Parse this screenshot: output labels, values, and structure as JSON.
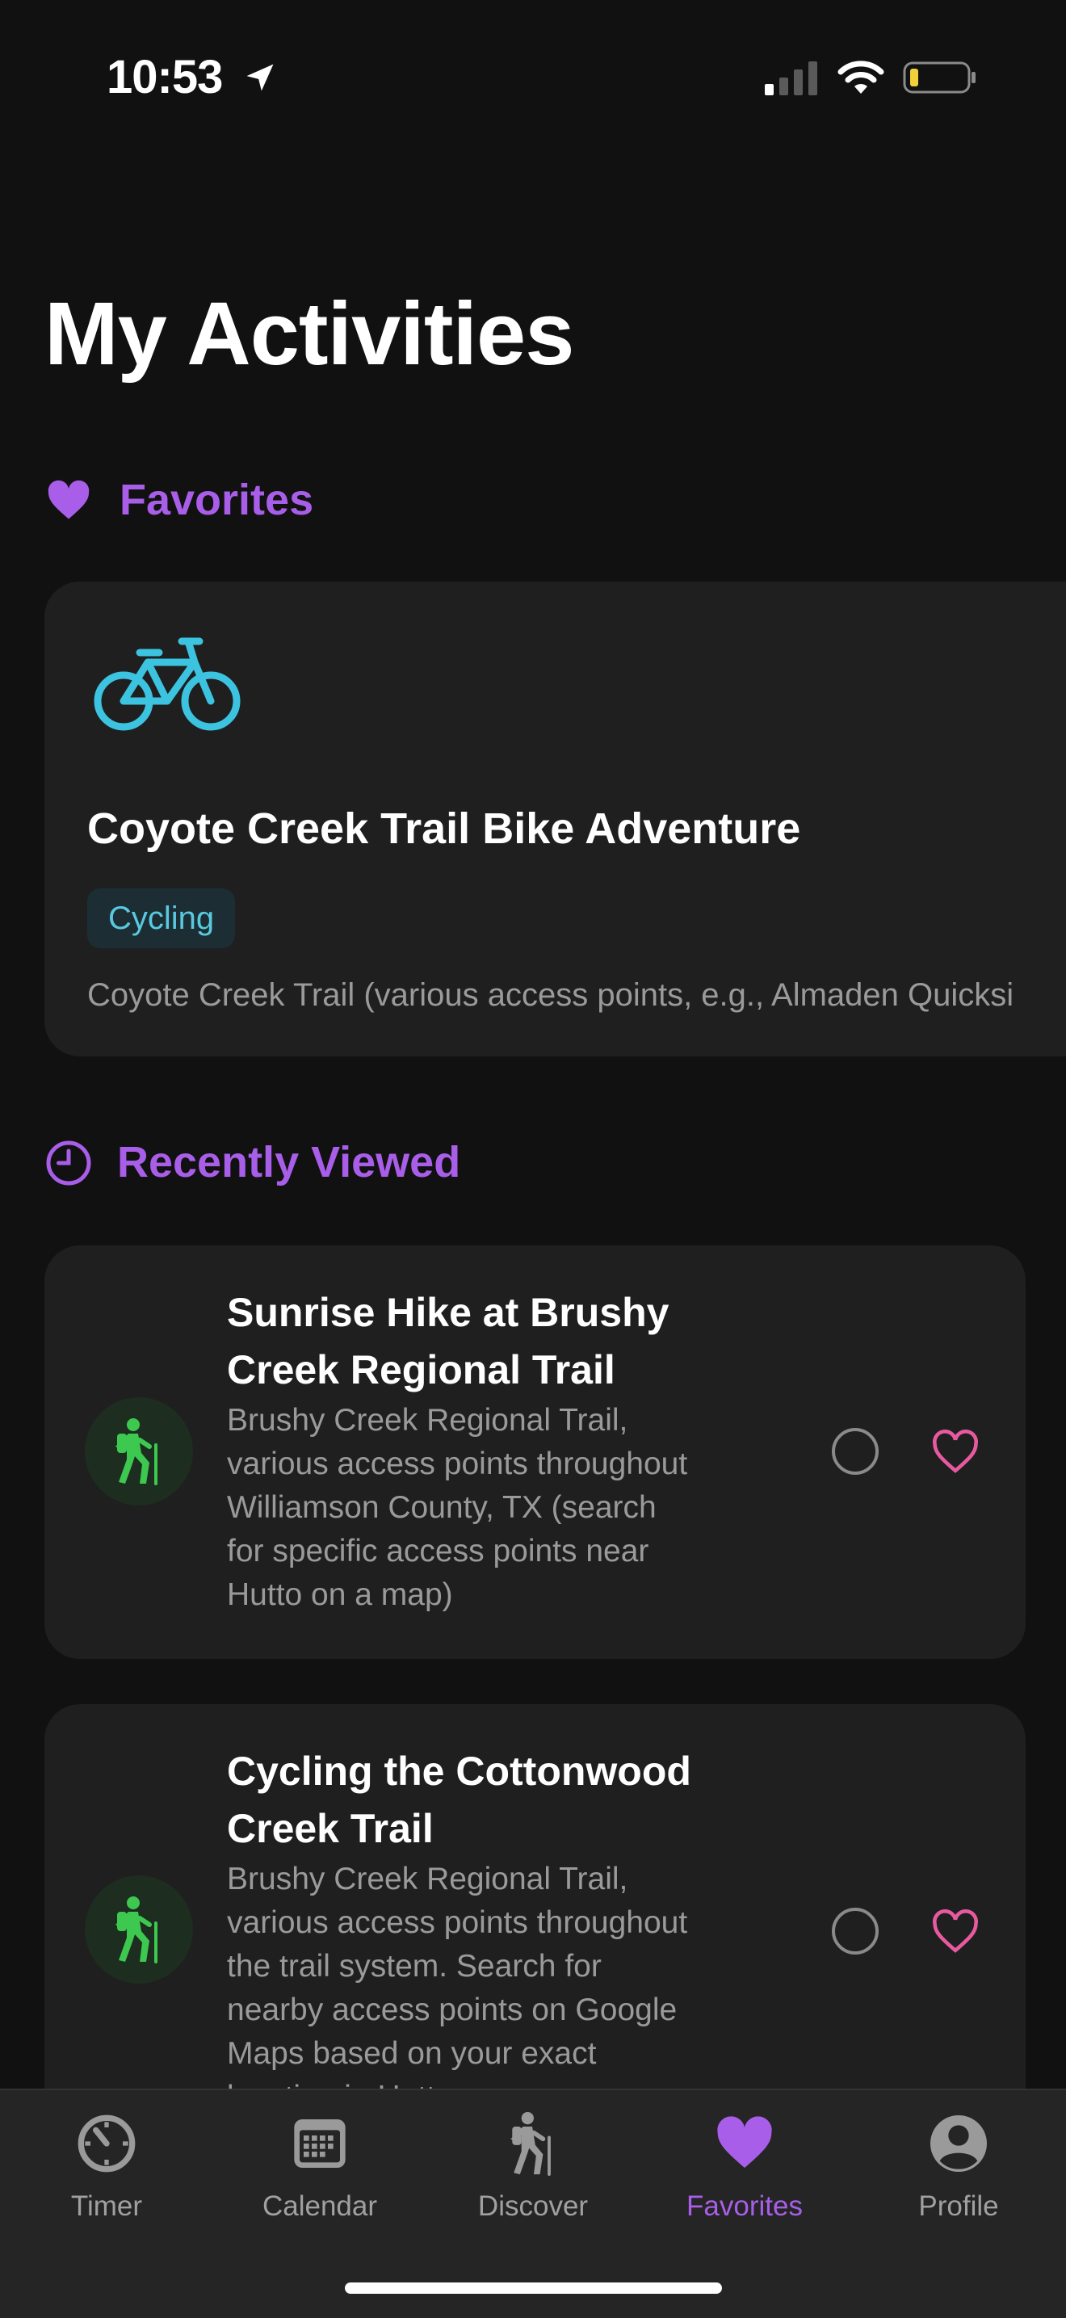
{
  "status_bar": {
    "time": "10:53"
  },
  "page": {
    "title": "My Activities"
  },
  "favorites": {
    "heading": "Favorites",
    "card": {
      "title": "Coyote Creek Trail Bike Adventure",
      "tag": "Cycling",
      "location": "Coyote Creek Trail (various access points, e.g., Almaden Quicksi",
      "icon": "bicycle-icon"
    }
  },
  "recently_viewed": {
    "heading": "Recently Viewed",
    "items": [
      {
        "title_line1": "Sunrise Hike at Brushy",
        "title_line2": "Creek Regional Trail",
        "desc_lines": [
          "Brushy Creek Regional Trail,",
          "various access points throughout",
          "Williamson County, TX (search",
          "for specific access points near",
          "Hutto on a map)"
        ],
        "icon": "hiker-icon"
      },
      {
        "title_line1": "Cycling the Cottonwood",
        "title_line2": "Creek Trail",
        "desc_lines": [
          "Brushy Creek Regional Trail,",
          "various access points throughout",
          "the trail system.  Search for",
          "nearby access points on Google",
          "Maps based on your exact",
          "location in Hutto."
        ],
        "icon": "hiker-icon"
      }
    ]
  },
  "tabs": [
    {
      "label": "Timer",
      "icon": "timer-icon"
    },
    {
      "label": "Calendar",
      "icon": "calendar-icon"
    },
    {
      "label": "Discover",
      "icon": "hiker-icon"
    },
    {
      "label": "Favorites",
      "icon": "heart-icon",
      "active": true
    },
    {
      "label": "Profile",
      "icon": "person-icon"
    }
  ],
  "colors": {
    "accent": "#a85ee8",
    "background": "#111111",
    "card": "#1f1f1f",
    "cycling": "#58c9e0",
    "hike_green": "#3dc84f",
    "heart_pink": "#e85aa0"
  }
}
